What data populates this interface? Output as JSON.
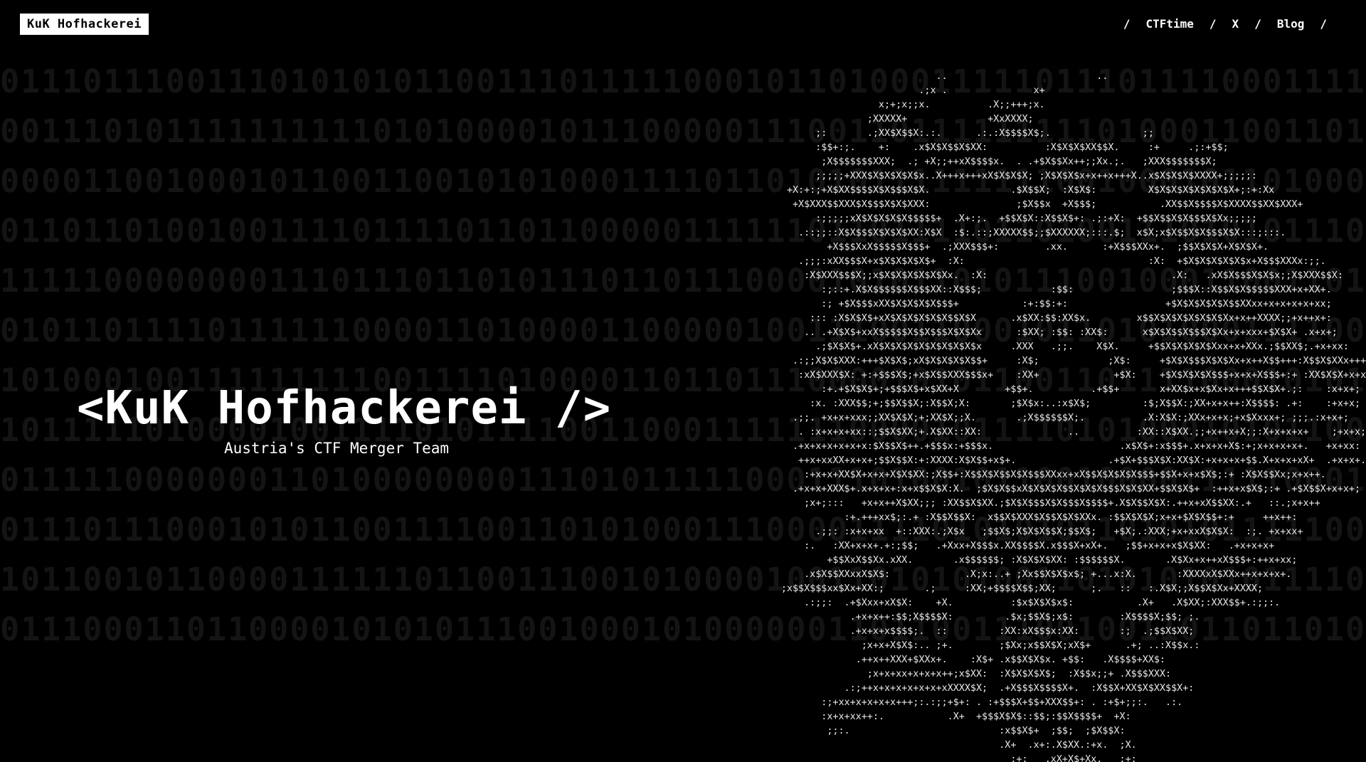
{
  "brand": {
    "label": "KuK Hofhackerei"
  },
  "nav": {
    "separator": "/",
    "links": [
      "CTFtime",
      "X",
      "Blog"
    ]
  },
  "hero": {
    "title": "<KuK Hofhackerei />",
    "subtitle": "Austria's CTF Merger Team"
  },
  "background_binary": [
    "0111011100111010101011001110111110001011010001111101110111100011110001001101110",
    "0011101011111111110101000010111000001110011011111111101000110011010001000111100",
    "0000110010001011001100101010001111011010101111111110010001011010001001011111011",
    "0110110100100111101111011011000001111110110111101101001110101011100100101110010",
    "1111100000000111011101101011101101110000101011010111001000110011011110111011110",
    "0101101111011111100001101000011000001001110011000101101010001111000011101101111",
    "1010001001111111110011110100001101101110000101011001101111000101011011000111000",
    "1011111010000100111101011110011000111111100001011110101000101011001100010100101",
    "0111110000000110100000000111010111110001110100101100100001111100010110010011010",
    "0111011100010101100111100110101000111000011110101010110101011111000110111110001",
    "1011001011000011111101100111001010000100110101010011010101010111100011011011100",
    "0111000110110000101010111001000101000000110110011100100110110110100111011011001"
  ],
  "ascii_art": [
    "                                         ..                          ..",
    "                                      .;x .               x+",
    "                               x;+;x;;x.          .X;;+++;x.",
    "                             ;XXXXX+              +XxXXXX;",
    "                    ;:       .;XX$X$$X:.:.      .:.:X$$$$X$;.                ;;",
    "                    :$$+:;.    +:    .x$X$X$$X$XX:          :X$X$X$XX$$X.     :+     .;:+$$;",
    "                     ;X$$$$$$$XXX;  .; +X;;++xX$$$$x.  . .+$X$$Xx++;;Xx.;.   ;XXX$$$$$$$X;",
    "                    ;;;;;+XXX$X$X$X$X$x..X+++x+++xX$X$X$X; ;X$X$X$x+x++x+++X..x$X$X$X$XXXX+;;;;;:",
    "               +X:+:;+X$XX$$$$X$X$$$X$X.              .$X$$X;  :X$X$:         X$X$X$X$X$X$X$X+;:+:Xx",
    "                +X$XXX$$XXX$X$$$X$X$XXX:               ;$X$$x  +X$$$;           .XX$$X$$$$X$XXXX$$XX$XXX+",
    "                    :;;;;;xX$X$X$X$X$$$$$+  .X+:;.  +$$X$X::X$$X$+: .;:+X:  +$$X$$X$X$$$X$Xx;;;;;",
    "                 .::;;::X$X$$$X$X$X$XX:X$X  :$:.::;XXXXX$$;;$XXXXXX;:::.$;  x$X;x$X$$X$X$$$X$X:::;:::.",
    "                      +X$$$XxX$$$$$X$$$+  .;XXX$$$+:        .xx.      :+X$$$XXx+.  ;$$X$X$X+X$X$X+.",
    "                 .;;;:xXX$$$X+x$X$X$X$X$+  :X:                                :X:  +$X$X$X$X$X$x+X$$$XXXx:;;.",
    "                  :X$XXX$$$X;;x$X$X$X$X$X$Xx.  :X:                                .X:   .xX$X$$$X$X$x;;X$XXX$$X:",
    "                     :;::+.X$X$$$$$$X$$$XX::X$$$;            :$$:                 ;$$$X::X$$X$X$$$$$XXX+x+XX+.",
    "                     :; +$X$$$xXX$X$X$X$X$$$+           :+:$$:+:                 +$X$X$X$X$X$$XXxx+x+x+x+x+xx;",
    "                   ::: :X$X$X$+xX$X$X$X$X$X$$X$X      .x$XX:$$:XX$x.        x$$X$X$X$X$X$X$Xx+x++XXXX;;+x++x+:",
    "                  .. .+X$X$+xxX$$$$$X$$X$$$X$X$Xx      :$XX; :$$: :XX$:      x$X$X$$X$$$X$Xx+x+xxx+$X$X+ .x+x+;",
    "                    .;$X$X$+.xX$X$X$X$X$X$X$X$X$x     .XXX   .;;.    X$X.     +$$X$X$X$X$Xxx+x+XXx.;$$XX$;.+x+xx:",
    "                .:;;X$X$XXX:+++$X$X$;xX$X$X$X$X$$+     :X$;            ;X$:     +$X$X$$$X$X$Xx+x++X$$+++:X$$X$XXx++++.",
    "                 :xX$XXX$X: +:+$$$X$;+x$X$$XXX$$$x+    :XX+             +$X:    +$X$X$X$X$$$+x+x+X$$$+:+ :XX$X$X+x+x:",
    "                     :+.+$X$X$+;+$$$X$+x$XX+X        +$$+.          .+$$+       x+XX$x+x$Xx+x+++$$X$X+.;:    :x+x+;",
    "                   :x. :XXX$$;+;$$X$$X;:X$$X;X:       ;$X$x:..:x$X$;         :$;X$$X:;XX+x+x++:X$$$$: .+:    :+x+x;",
    "                .;;. +x+x+xxx;;XX$X$X;+;XX$X;;X.       .;X$$$$$$X;.          .X:X$X:;XXx+x+x;+x$Xxxx+; ;;;.:x+x+;",
    "                 . :x+x+x+xx::;$$X$XX;+.X$XX::XX:               ..          :XX::X$XX.;;+x++x+X;;:X+x+x+x+    ;+x+x;",
    "                .+x+x+x+x+x+x:$X$$X$++.+$$$x:+$$$x.                      .x$X$+:x$$$+.x+x+x+X$:+;x+x+x+x+.   +x+xx:",
    "                 ++x+xxXX+x+x+;$$X$$X:+:XXXX:X$X$$+x$+.                .+$X+$$$X$X:XX$X:+x+x+x+$$.X+x+x+xX+  .+x+x+.",
    "                  :+x+x+XX$X+x+x+X$X$XX:;X$$+:X$$X$X$$X$X$$$XXxx+xX$$X$X$X$X$$$+$$X+x+x$X$;:+ :X$X$$Xx;x+x++.",
    "                .+x+x+XXX$+.x+x+x+:x+x$$X$X:X.  ;$X$X$$xX$X$X$X$$X$X$X$$$X$X$XX+$$X$X$+  :++x+x$X$;:+ .+$X$$X+x+x+;",
    "                  ;x+;:::   +x+x++X$XX;;; :XX$$X$XX.;$X$X$$$X$X$$$X$$$$+.X$X$$X$X:.++x+xX$$XX:.+   ::.;x+x++",
    "                         :+.+++xx$;:.+ :X$$X$$X:  x$$X$XXX$X$$X$X$XXx. :$$X$X$X;x+x+$X$X$$+:+     ++x++:",
    "                    .;;: :x+x+xx  +::XXX:.;X$x   ;$$X$;X$X$X$$X;$$X$;   +$X;.:XXX;+x+xxX$X$X:  :;. +x+xx+",
    "                  :.   :XX+x+x+.+:;$$;   .+Xxx+X$$$x.XX$$$$X.x$$$X+xX+.   ;$$+x+x+x$X$XX:   .+x+x+x+",
    "                      +$$XxX$$Xx.xXX.       .x$$$$$$; :X$X$X$XX: :$$$$$$X.       .X$Xx+x++xX$$$+:++x+xx;",
    "                  .x$X$$XXxxX$X$:             .X;x:..+ ;Xx$$X$X$x$; +...x:X.       :XXXXxX$XXx++x+x+x+.",
    "              ;x$$X$$$xx$Xx+XX:;       .;     :XX;+$$$$X$$;XX;      ;.   ::   :.X$X;;X$$X$Xx+XXXX;",
    "                  .:;;:  .+$Xxx+xX$X:    +X.          :$x$X$X$x$:           .X+   .X$XX;:XXX$$+.:;;:.",
    "                          .+x+x++:$$;X$$$$X:         .$x;$$X$;x$:        :X$$$$X;$$; ;.",
    "                          .+x+x+x$$$$;.  ::         :XX:xX$$$x:XX:       :;  .;$$X$XX;",
    "                            ;x+x+X$X$:.. ;+.        ;$Xx;x$$X$X;xX$+      .+; ..:X$$x.:",
    "                           .++x++XXX+$XXx+.    :X$+ .x$$X$X$x. +$$:   .X$$$$+XX$:",
    "                             ;x+x+xx+x+x+x++;x$XX:  :X$X$X$X$;  :X$$x;;+ .X$$$XXX:",
    "                         .:;++x+x+x+x+x+x+xXXXX$X;  .+X$$$X$$$$X+.  :X$$X+XX$X$XX$$X+:",
    "                     :;+xx+x+x+x+x+++;:.:;;+$+: . :+$$$X+$$+XXX$$+: . :+$+;;:.   .:.",
    "                     :x+x+xx++:.           .X+  +$$$X$X$::$$;:$$X$$$$+  +X:",
    "                      ;;:.                          :x$$X$+  ;$$;  ;$X$$X:",
    "                                                    .X+  .x+:.X$XX.:+x.  ;X.",
    "                                                      :+:   .xX+X$+Xx.   :+:"
  ]
}
